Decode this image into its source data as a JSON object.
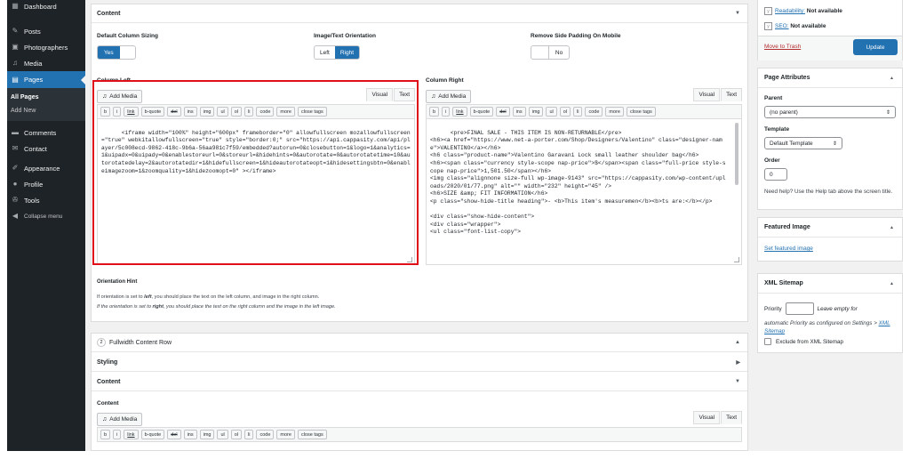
{
  "sidebar": {
    "items": [
      {
        "label": "Dashboard",
        "icon": "dashboard-icon"
      },
      {
        "label": "Posts",
        "icon": "pin-icon"
      },
      {
        "label": "Photographers",
        "icon": "photographers-icon"
      },
      {
        "label": "Media",
        "icon": "media-icon"
      },
      {
        "label": "Pages",
        "icon": "pages-icon"
      }
    ],
    "submenu": [
      "All Pages",
      "Add New"
    ],
    "items2": [
      {
        "label": "Comments",
        "icon": "comments-icon"
      },
      {
        "label": "Contact",
        "icon": "contact-icon"
      },
      {
        "label": "Appearance",
        "icon": "appearance-icon"
      },
      {
        "label": "Profile",
        "icon": "profile-icon"
      },
      {
        "label": "Tools",
        "icon": "tools-icon"
      },
      {
        "label": "Collapse menu",
        "icon": "collapse-icon"
      }
    ]
  },
  "content_header": "Content",
  "options": {
    "column_sizing": {
      "label": "Default Column Sizing",
      "value": "Yes"
    },
    "orientation": {
      "label": "Image/Text Orientation",
      "left": "Left",
      "right": "Right"
    },
    "padding": {
      "label": "Remove Side Padding On Mobile",
      "value": "No"
    }
  },
  "column_left": {
    "label": "Column Left",
    "add_media": "Add Media",
    "tab_visual": "Visual",
    "tab_text": "Text",
    "code": "<iframe width=\"100%\" height=\"600px\" frameborder=\"0\" allowfullscreen mozallowfullscreen=\"true\" webkitallowfullscreen=\"true\" style=\"border:0;\" src=\"https://api.cappasity.com/api/player/5c008ecd-9862-418c-9b6a-56aa981c7f59/embedded?autorun=0&closebutton=1&logo=1&analytics=1&uipadx=0&uipady=0&enablestoreurl=0&storeurl=&hidehints=0&autorotate=0&autorotatetime=10&autorotatedelay=2&autorotatedir=1&hidefullscreen=1&hideautorotateopt=1&hidesettingsbtn=0&enableimagezoom=1&zoomquality=1&hidezoomopt=0\" ></iframe>"
  },
  "column_right": {
    "label": "Column Right",
    "add_media": "Add Media",
    "tab_visual": "Visual",
    "tab_text": "Text",
    "code": "<pre>FINAL SALE - THIS ITEM IS NON-RETURNABLE</pre>\n<h6><a href=\"https://www.net-a-porter.com/Shop/Designers/Valentino\" class=\"designer-name\">VALENTINO</a></h6>\n<h6 class=\"product-name\">Valentino Garavani Lock small leather shoulder bag</h6>\n<h6><span class=\"currency style-scope nap-price\">$</span><span class=\"full-price style-scope nap-price\">1,501.50</span></h6>\n<img class=\"alignnone size-full wp-image-9143\" src=\"https://cappasity.com/wp-content/uploads/2020/01/77.png\" alt=\"\" width=\"232\" height=\"45\" />\n<h6>SIZE &amp; FIT INFORMATION</h6>\n<p class=\"show-hide-title heading\">- <b>This item's measuremen</b><b>ts are:</b></p>\n\n<div class=\"show-hide-content\">\n<div class=\"wrapper\">\n<ul class=\"font-list-copy\">"
  },
  "quicktags": [
    "b",
    "i",
    "link",
    "b-quote",
    "del",
    "ins",
    "img",
    "ul",
    "ol",
    "li",
    "code",
    "more",
    "close tags"
  ],
  "orientation_hint": {
    "title": "Orientation Hint",
    "line1_pre": "If orientation is set to ",
    "line1_em": "left",
    "line1_post": ", you should place the text on the left column, and image in the right column.",
    "line2_pre": "If the orientation is set to ",
    "line2_em": "right",
    "line2_post": ", you should place the text on the right column and the image in the left image."
  },
  "row2": {
    "num": "2",
    "title": "Fullwidth Content Row",
    "styling": "Styling",
    "content": "Content",
    "content_label": "Content",
    "add_media": "Add Media",
    "tab_visual": "Visual",
    "tab_text": "Text"
  },
  "publish": {
    "readability_label": "Readability:",
    "readability_value": "Not available",
    "seo_label": "SEO:",
    "seo_value": "Not available",
    "trash": "Move to Trash",
    "update": "Update"
  },
  "page_attributes": {
    "title": "Page Attributes",
    "parent_label": "Parent",
    "parent_value": "(no parent)",
    "template_label": "Template",
    "template_value": "Default Template",
    "order_label": "Order",
    "order_value": "0",
    "help": "Need help? Use the Help tab above the screen title."
  },
  "featured_image": {
    "title": "Featured Image",
    "link": "Set featured image"
  },
  "xml_sitemap": {
    "title": "XML Sitemap",
    "priority_label": "Priority",
    "priority_hint": "Leave empty for",
    "auto_text": "automatic Priority as configured on Settings >",
    "auto_link": "XML Sitemap",
    "exclude": "Exclude from XML Sitemap"
  },
  "colors": {
    "accent": "#2271b1",
    "sidebar": "#1d2327",
    "highlight": "#e0101a"
  }
}
